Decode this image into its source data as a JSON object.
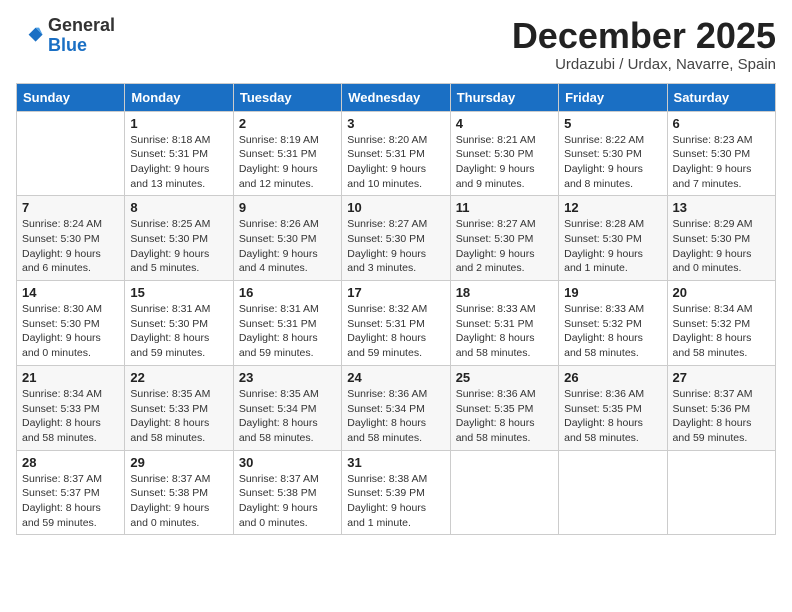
{
  "logo": {
    "general": "General",
    "blue": "Blue"
  },
  "header": {
    "month": "December 2025",
    "location": "Urdazubi / Urdax, Navarre, Spain"
  },
  "days_of_week": [
    "Sunday",
    "Monday",
    "Tuesday",
    "Wednesday",
    "Thursday",
    "Friday",
    "Saturday"
  ],
  "weeks": [
    [
      {
        "day": "",
        "info": ""
      },
      {
        "day": "1",
        "info": "Sunrise: 8:18 AM\nSunset: 5:31 PM\nDaylight: 9 hours\nand 13 minutes."
      },
      {
        "day": "2",
        "info": "Sunrise: 8:19 AM\nSunset: 5:31 PM\nDaylight: 9 hours\nand 12 minutes."
      },
      {
        "day": "3",
        "info": "Sunrise: 8:20 AM\nSunset: 5:31 PM\nDaylight: 9 hours\nand 10 minutes."
      },
      {
        "day": "4",
        "info": "Sunrise: 8:21 AM\nSunset: 5:30 PM\nDaylight: 9 hours\nand 9 minutes."
      },
      {
        "day": "5",
        "info": "Sunrise: 8:22 AM\nSunset: 5:30 PM\nDaylight: 9 hours\nand 8 minutes."
      },
      {
        "day": "6",
        "info": "Sunrise: 8:23 AM\nSunset: 5:30 PM\nDaylight: 9 hours\nand 7 minutes."
      }
    ],
    [
      {
        "day": "7",
        "info": "Sunrise: 8:24 AM\nSunset: 5:30 PM\nDaylight: 9 hours\nand 6 minutes."
      },
      {
        "day": "8",
        "info": "Sunrise: 8:25 AM\nSunset: 5:30 PM\nDaylight: 9 hours\nand 5 minutes."
      },
      {
        "day": "9",
        "info": "Sunrise: 8:26 AM\nSunset: 5:30 PM\nDaylight: 9 hours\nand 4 minutes."
      },
      {
        "day": "10",
        "info": "Sunrise: 8:27 AM\nSunset: 5:30 PM\nDaylight: 9 hours\nand 3 minutes."
      },
      {
        "day": "11",
        "info": "Sunrise: 8:27 AM\nSunset: 5:30 PM\nDaylight: 9 hours\nand 2 minutes."
      },
      {
        "day": "12",
        "info": "Sunrise: 8:28 AM\nSunset: 5:30 PM\nDaylight: 9 hours\nand 1 minute."
      },
      {
        "day": "13",
        "info": "Sunrise: 8:29 AM\nSunset: 5:30 PM\nDaylight: 9 hours\nand 0 minutes."
      }
    ],
    [
      {
        "day": "14",
        "info": "Sunrise: 8:30 AM\nSunset: 5:30 PM\nDaylight: 9 hours\nand 0 minutes."
      },
      {
        "day": "15",
        "info": "Sunrise: 8:31 AM\nSunset: 5:30 PM\nDaylight: 8 hours\nand 59 minutes."
      },
      {
        "day": "16",
        "info": "Sunrise: 8:31 AM\nSunset: 5:31 PM\nDaylight: 8 hours\nand 59 minutes."
      },
      {
        "day": "17",
        "info": "Sunrise: 8:32 AM\nSunset: 5:31 PM\nDaylight: 8 hours\nand 59 minutes."
      },
      {
        "day": "18",
        "info": "Sunrise: 8:33 AM\nSunset: 5:31 PM\nDaylight: 8 hours\nand 58 minutes."
      },
      {
        "day": "19",
        "info": "Sunrise: 8:33 AM\nSunset: 5:32 PM\nDaylight: 8 hours\nand 58 minutes."
      },
      {
        "day": "20",
        "info": "Sunrise: 8:34 AM\nSunset: 5:32 PM\nDaylight: 8 hours\nand 58 minutes."
      }
    ],
    [
      {
        "day": "21",
        "info": "Sunrise: 8:34 AM\nSunset: 5:33 PM\nDaylight: 8 hours\nand 58 minutes."
      },
      {
        "day": "22",
        "info": "Sunrise: 8:35 AM\nSunset: 5:33 PM\nDaylight: 8 hours\nand 58 minutes."
      },
      {
        "day": "23",
        "info": "Sunrise: 8:35 AM\nSunset: 5:34 PM\nDaylight: 8 hours\nand 58 minutes."
      },
      {
        "day": "24",
        "info": "Sunrise: 8:36 AM\nSunset: 5:34 PM\nDaylight: 8 hours\nand 58 minutes."
      },
      {
        "day": "25",
        "info": "Sunrise: 8:36 AM\nSunset: 5:35 PM\nDaylight: 8 hours\nand 58 minutes."
      },
      {
        "day": "26",
        "info": "Sunrise: 8:36 AM\nSunset: 5:35 PM\nDaylight: 8 hours\nand 58 minutes."
      },
      {
        "day": "27",
        "info": "Sunrise: 8:37 AM\nSunset: 5:36 PM\nDaylight: 8 hours\nand 59 minutes."
      }
    ],
    [
      {
        "day": "28",
        "info": "Sunrise: 8:37 AM\nSunset: 5:37 PM\nDaylight: 8 hours\nand 59 minutes."
      },
      {
        "day": "29",
        "info": "Sunrise: 8:37 AM\nSunset: 5:38 PM\nDaylight: 9 hours\nand 0 minutes."
      },
      {
        "day": "30",
        "info": "Sunrise: 8:37 AM\nSunset: 5:38 PM\nDaylight: 9 hours\nand 0 minutes."
      },
      {
        "day": "31",
        "info": "Sunrise: 8:38 AM\nSunset: 5:39 PM\nDaylight: 9 hours\nand 1 minute."
      },
      {
        "day": "",
        "info": ""
      },
      {
        "day": "",
        "info": ""
      },
      {
        "day": "",
        "info": ""
      }
    ]
  ]
}
